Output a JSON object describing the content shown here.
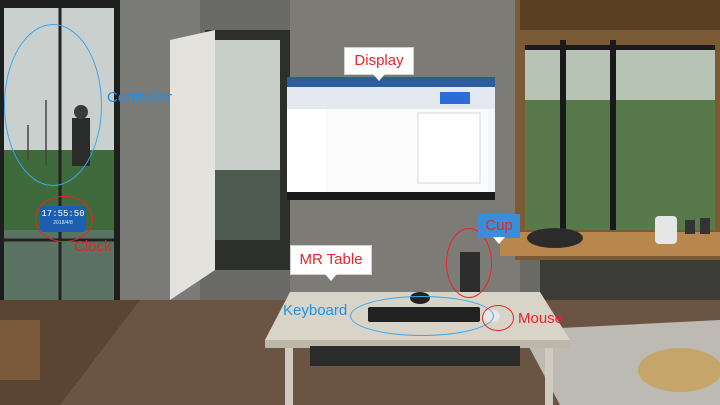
{
  "annotations": {
    "display": "Display",
    "controller": "Controller",
    "clock": "Clock",
    "cup": "Cup",
    "mr_table": "MR Table",
    "keyboard": "Keyboard",
    "mouse": "Mouse"
  },
  "clock_widget": {
    "time": "17:55:50",
    "date": "2018/4/8"
  },
  "colors": {
    "annotation_blue": "#1e90e8",
    "annotation_red": "#e8242a",
    "clock_panel": "#1b5fae"
  }
}
